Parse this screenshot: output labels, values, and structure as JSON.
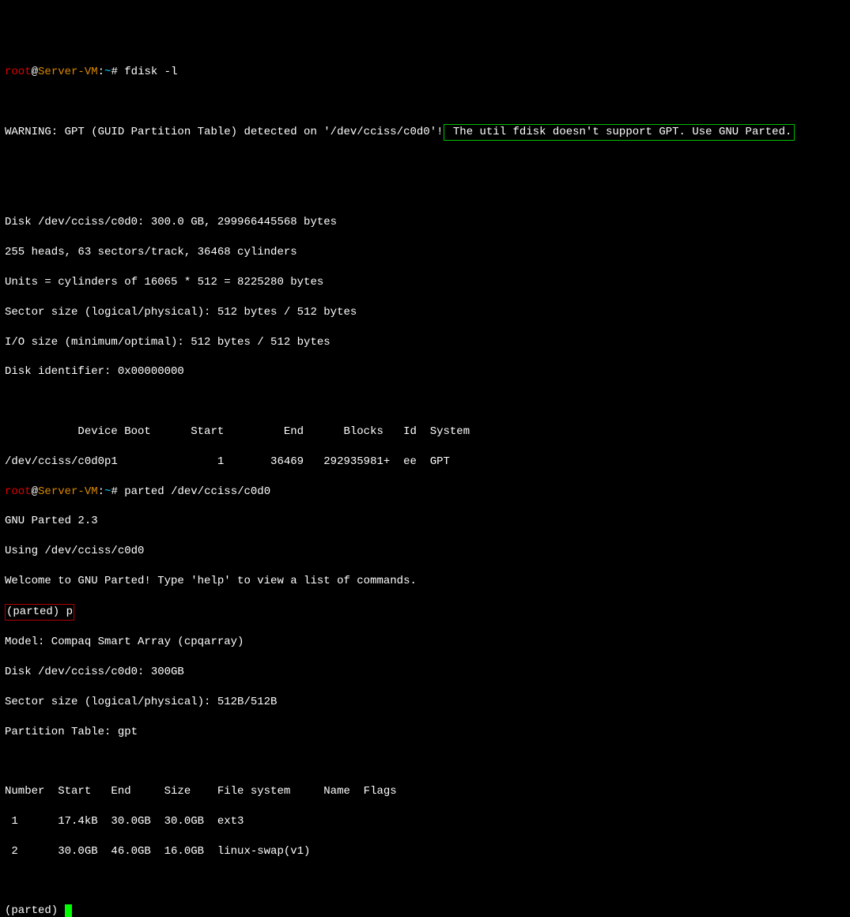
{
  "prompt1": {
    "user": "root",
    "at": "@",
    "host": "Server-VM",
    "colon": ":",
    "path": "~",
    "hash": "# ",
    "cmd": "fdisk -l"
  },
  "blank1": " ",
  "warning": {
    "prefix": "WARNING: GPT (GUID Partition Table) detected on '/dev/cciss/c0d0'!",
    "boxed": " The util fdisk doesn't support GPT. Use GNU Parted."
  },
  "blank2": " ",
  "blank3": " ",
  "disk_info": {
    "l1": "Disk /dev/cciss/c0d0: 300.0 GB, 299966445568 bytes",
    "l2": "255 heads, 63 sectors/track, 36468 cylinders",
    "l3": "Units = cylinders of 16065 * 512 = 8225280 bytes",
    "l4": "Sector size (logical/physical): 512 bytes / 512 bytes",
    "l5": "I/O size (minimum/optimal): 512 bytes / 512 bytes",
    "l6": "Disk identifier: 0x00000000"
  },
  "blank4": " ",
  "table_header": "           Device Boot      Start         End      Blocks   Id  System",
  "table_row": "/dev/cciss/c0d0p1               1       36469   292935981+  ee  GPT",
  "prompt2": {
    "user": "root",
    "at": "@",
    "host": "Server-VM",
    "colon": ":",
    "path": "~",
    "hash": "# ",
    "cmd": "parted /dev/cciss/c0d0"
  },
  "parted": {
    "l1": "GNU Parted 2.3",
    "l2": "Using /dev/cciss/c0d0",
    "l3": "Welcome to GNU Parted! Type 'help' to view a list of commands."
  },
  "parted_prompt_box": {
    "prompt": "(parted) ",
    "cmd": "p"
  },
  "model_info": {
    "l1": "Model: Compaq Smart Array (cpqarray)",
    "l2": "Disk /dev/cciss/c0d0: 300GB",
    "l3": "Sector size (logical/physical): 512B/512B",
    "l4": "Partition Table: gpt"
  },
  "blank5": " ",
  "part_header": "Number  Start   End     Size    File system     Name  Flags",
  "part_row1": " 1      17.4kB  30.0GB  30.0GB  ext3",
  "part_row2": " 2      30.0GB  46.0GB  16.0GB  linux-swap(v1)",
  "blank6": " ",
  "final_prompt": "(parted) "
}
